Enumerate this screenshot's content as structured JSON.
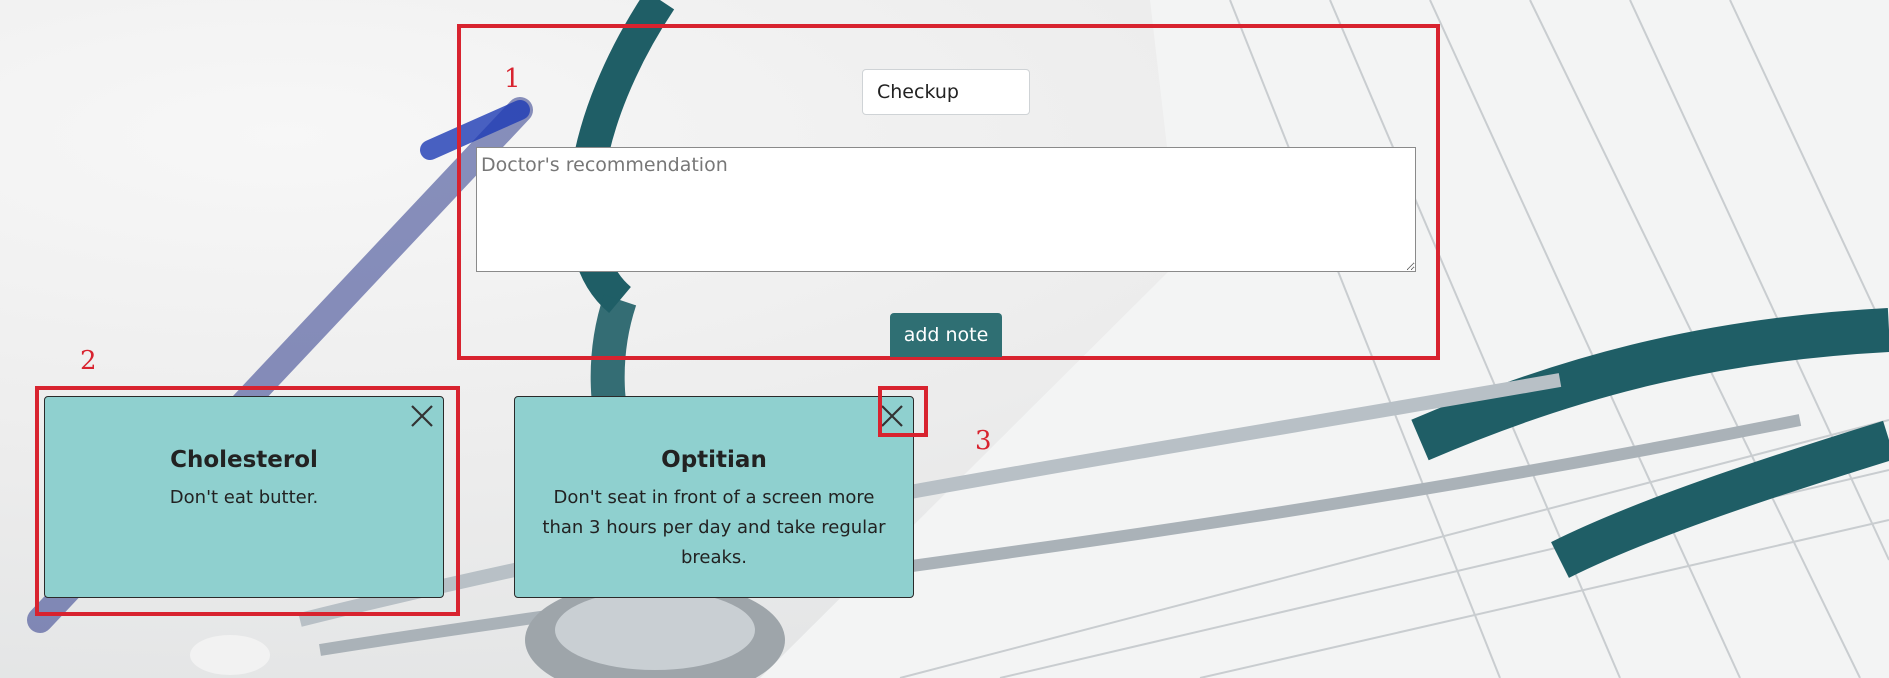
{
  "form": {
    "title_value": "Checkup",
    "content_placeholder": "Doctor's recommendation",
    "add_button_label": "add note"
  },
  "notes": [
    {
      "title": "Cholesterol",
      "content": "Don't eat butter."
    },
    {
      "title": "Optitian",
      "content": "Don't seat in front of a screen more than 3 hours per day and take regular breaks."
    }
  ],
  "annotations": [
    "1",
    "2",
    "3"
  ],
  "colors": {
    "note_bg": "#8fd0cf",
    "button_bg": "#2f6f73",
    "annotation": "#d8232f"
  },
  "icons": [
    "close-icon"
  ]
}
